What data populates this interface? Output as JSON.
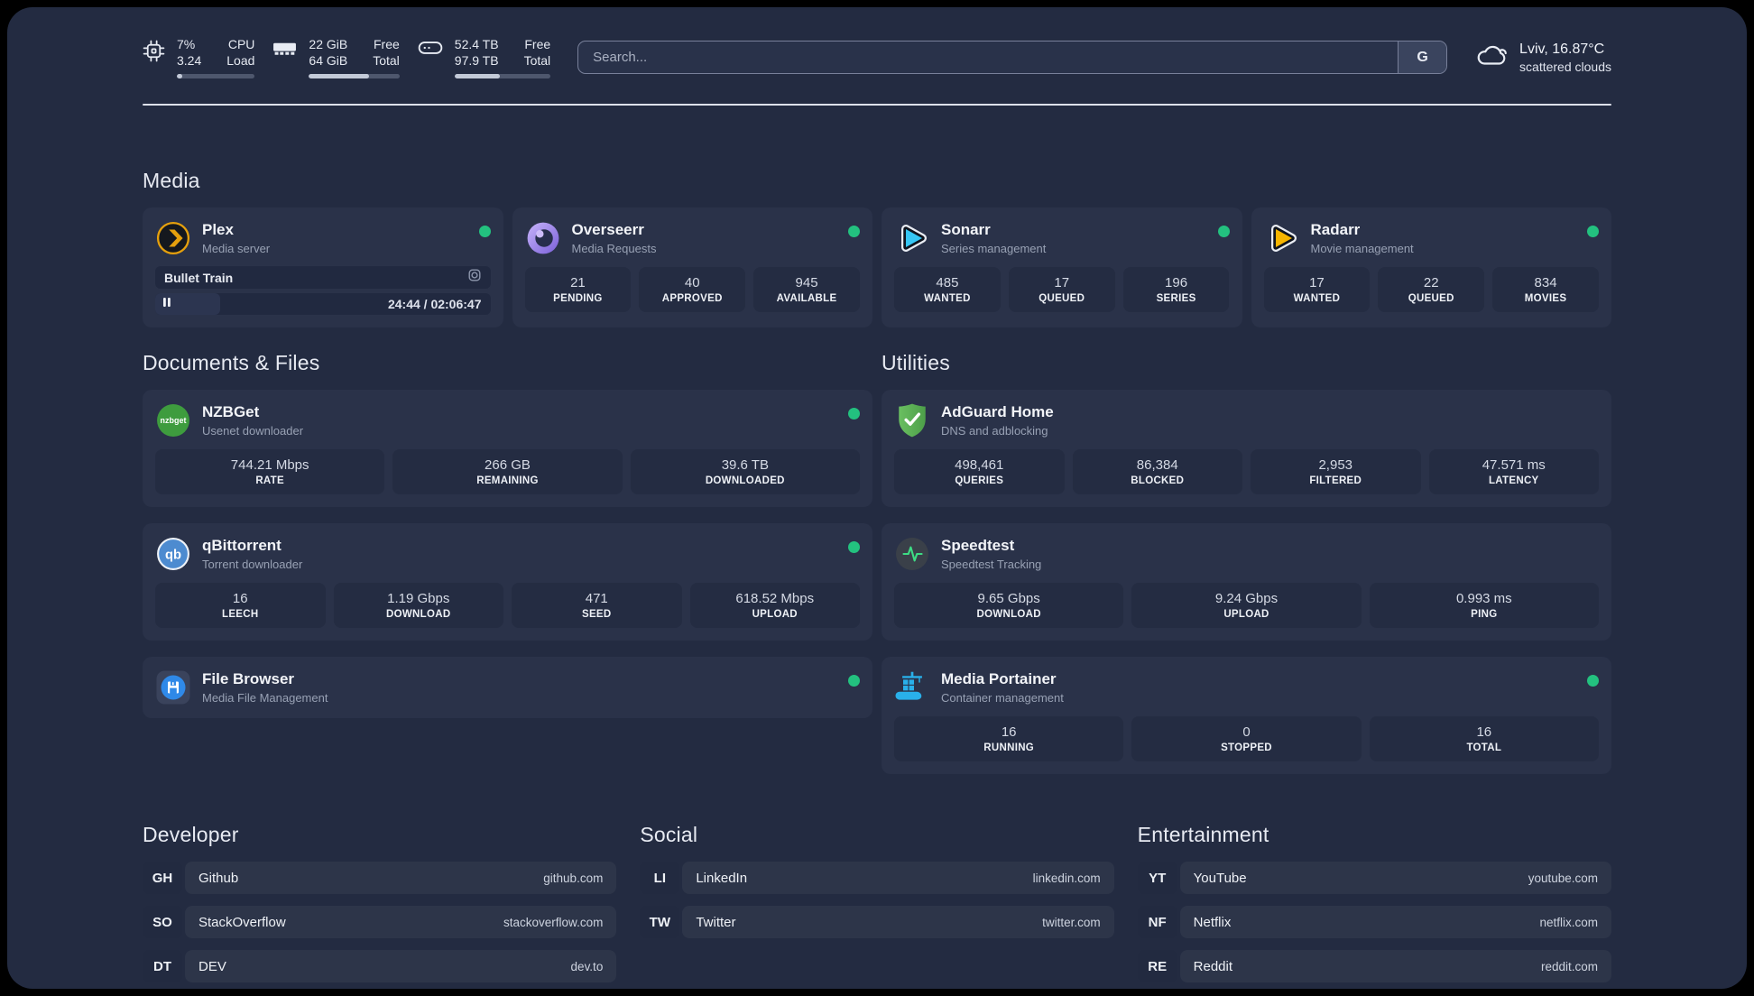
{
  "colors": {
    "status_online": "#23c17f",
    "plex_amber": "#e5a00d",
    "overseerr_purple": "#8a6fe0",
    "sonarr_blue": "#36c6f4",
    "radarr_yellow": "#f7b500",
    "nzbget_green": "#3e9c3e",
    "adguard_green": "#5cb253",
    "qbittorrent_blue": "#4d8bd0",
    "speedtest_green": "#3ddc84",
    "filebrowser_blue": "#2f89e8",
    "portainer_blue": "#29b0ea"
  },
  "header": {
    "stats": [
      {
        "name": "cpu",
        "value_top": "7%",
        "value_bottom": "3.24",
        "label_top": "CPU",
        "label_bottom": "Load",
        "progress_pct": 7
      },
      {
        "name": "memory",
        "value_top": "22 GiB",
        "value_bottom": "64 GiB",
        "label_top": "Free",
        "label_bottom": "Total",
        "progress_pct": 66
      },
      {
        "name": "storage",
        "value_top": "52.4 TB",
        "value_bottom": "97.9 TB",
        "label_top": "Free",
        "label_bottom": "Total",
        "progress_pct": 47
      }
    ],
    "search": {
      "placeholder": "Search...",
      "button": "G"
    },
    "weather": {
      "location_temp": "Lviv, 16.87°C",
      "condition": "scattered clouds"
    }
  },
  "media": {
    "title": "Media",
    "plex": {
      "title": "Plex",
      "subtitle": "Media server",
      "now_playing": "Bullet Train",
      "time": "24:44 / 02:06:47",
      "elapsed_pct": 19.5
    },
    "overseerr": {
      "title": "Overseerr",
      "subtitle": "Media Requests",
      "stats": [
        {
          "value": "21",
          "label": "PENDING"
        },
        {
          "value": "40",
          "label": "APPROVED"
        },
        {
          "value": "945",
          "label": "AVAILABLE"
        }
      ]
    },
    "sonarr": {
      "title": "Sonarr",
      "subtitle": "Series management",
      "stats": [
        {
          "value": "485",
          "label": "WANTED"
        },
        {
          "value": "17",
          "label": "QUEUED"
        },
        {
          "value": "196",
          "label": "SERIES"
        }
      ]
    },
    "radarr": {
      "title": "Radarr",
      "subtitle": "Movie management",
      "stats": [
        {
          "value": "17",
          "label": "WANTED"
        },
        {
          "value": "22",
          "label": "QUEUED"
        },
        {
          "value": "834",
          "label": "MOVIES"
        }
      ]
    }
  },
  "documents": {
    "title": "Documents & Files",
    "nzbget": {
      "title": "NZBGet",
      "subtitle": "Usenet downloader",
      "stats": [
        {
          "value": "744.21 Mbps",
          "label": "RATE"
        },
        {
          "value": "266 GB",
          "label": "REMAINING"
        },
        {
          "value": "39.6 TB",
          "label": "DOWNLOADED"
        }
      ]
    },
    "qbittorrent": {
      "title": "qBittorrent",
      "subtitle": "Torrent downloader",
      "stats": [
        {
          "value": "16",
          "label": "LEECH"
        },
        {
          "value": "1.19 Gbps",
          "label": "DOWNLOAD"
        },
        {
          "value": "471",
          "label": "SEED"
        },
        {
          "value": "618.52 Mbps",
          "label": "UPLOAD"
        }
      ]
    },
    "filebrowser": {
      "title": "File Browser",
      "subtitle": "Media File Management"
    }
  },
  "utilities": {
    "title": "Utilities",
    "adguard": {
      "title": "AdGuard Home",
      "subtitle": "DNS and adblocking",
      "stats": [
        {
          "value": "498,461",
          "label": "QUERIES"
        },
        {
          "value": "86,384",
          "label": "BLOCKED"
        },
        {
          "value": "2,953",
          "label": "FILTERED"
        },
        {
          "value": "47.571 ms",
          "label": "LATENCY"
        }
      ]
    },
    "speedtest": {
      "title": "Speedtest",
      "subtitle": "Speedtest Tracking",
      "stats": [
        {
          "value": "9.65 Gbps",
          "label": "DOWNLOAD"
        },
        {
          "value": "9.24 Gbps",
          "label": "UPLOAD"
        },
        {
          "value": "0.993 ms",
          "label": "PING"
        }
      ]
    },
    "portainer": {
      "title": "Media Portainer",
      "subtitle": "Container management",
      "stats": [
        {
          "value": "16",
          "label": "RUNNING"
        },
        {
          "value": "0",
          "label": "STOPPED"
        },
        {
          "value": "16",
          "label": "TOTAL"
        }
      ]
    }
  },
  "bookmarks": {
    "developer": {
      "title": "Developer",
      "items": [
        {
          "abbr": "GH",
          "name": "Github",
          "url": "github.com"
        },
        {
          "abbr": "SO",
          "name": "StackOverflow",
          "url": "stackoverflow.com"
        },
        {
          "abbr": "DT",
          "name": "DEV",
          "url": "dev.to"
        }
      ]
    },
    "social": {
      "title": "Social",
      "items": [
        {
          "abbr": "LI",
          "name": "LinkedIn",
          "url": "linkedin.com"
        },
        {
          "abbr": "TW",
          "name": "Twitter",
          "url": "twitter.com"
        }
      ]
    },
    "entertainment": {
      "title": "Entertainment",
      "items": [
        {
          "abbr": "YT",
          "name": "YouTube",
          "url": "youtube.com"
        },
        {
          "abbr": "NF",
          "name": "Netflix",
          "url": "netflix.com"
        },
        {
          "abbr": "RE",
          "name": "Reddit",
          "url": "reddit.com"
        }
      ]
    }
  }
}
